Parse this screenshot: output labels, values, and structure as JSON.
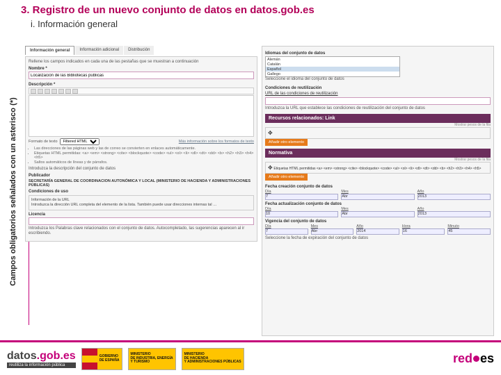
{
  "title": "3. Registro de un nuevo conjunto de datos en datos.gob.es",
  "subtitle": "i. Información general",
  "sidebar": "Campos obligatorios señalados con un asterisco (*)",
  "tabs": {
    "a": "Información general",
    "b": "Información adicional",
    "c": "Distribución"
  },
  "hint_top": "Rellene los campos indicados en cada una de las pestañas que se muestran a continuación",
  "nombre_label": "Nombre *",
  "nombre_value": "Localización de las Bibliotecas públicas",
  "desc_label": "Descripción *",
  "fmt_label": "Formato de texto",
  "fmt_opt": "Filtered HTML",
  "fmt_more": "Más información sobre los formatos de texto",
  "tips": {
    "a": "Las direcciones de las páginas web y las de correo se convierten en enlaces automáticamente.",
    "b": "Etiquetas HTML permitidas: <a> <em> <strong> <cite> <blockquote> <code> <ul> <ol> <li> <dl> <dt> <dd> <b> <h2> <h3> <h4> <h5>",
    "c": "Saltos automáticos de líneas y de párrafos."
  },
  "desc_hint": "Introduzca la descripción del conjunto de datos",
  "pub_label": "Publicador",
  "pub_value": "SECRETARÍA GENERAL DE COORDINACION AUTONÓMICA Y LOCAL (MINISTERIO DE HACIENDA Y ADMINISTRACIONES PÚBLICAS)",
  "url_label": "Condiciones de uso",
  "url_box_a": "Información de la URL",
  "url_box_b": "Introduzca la dirección URL completa del elemento de la lista. También puede usar direcciones internas tal …",
  "lic_label": "Licencia",
  "lic_hint": "Introduzca los Palabras clave relacionados con el conjunto de datos. Autocompletado, las sugerencias aparecen al ir escribiendo.",
  "idiomas_label": "Idiomas del conjunto de datos",
  "idiomas": {
    "a": "Alemán",
    "b": "Catalán",
    "c": "Español",
    "d": "Gallego"
  },
  "idiomas_hint": "Seleccione el idioma del conjunto de datos",
  "cond_label": "Condiciones de reutilización",
  "cond_sub": "URL de las condiciones de reutilización",
  "cond_hint": "Introduzca la URL que establece las condiciones de reutilización del conjunto de datos",
  "recursos_hdr": "Recursos relacionados: Link",
  "mostrar": "Mostrar pesos de la fila",
  "btn_add": "Añadir otro elemento",
  "normativa_hdr": "Normativa",
  "normativa_row": "Etiquetas HTML permitidas <a> <em> <strong> <cite> <blockquote> <code> <ul> <ol> <li> <dl> <dt> <dd> <b> <h2> <h3> <h4> <h5>",
  "date1_label": "Fecha creación conjunto de datos",
  "date2_label": "Fecha actualización conjunto de datos",
  "date3_label": "Vigencia del conjunto de datos",
  "dh": {
    "dia": "Día",
    "mes": "Mes",
    "anio": "Año",
    "hora": "Hora",
    "min": "Minuto"
  },
  "dv": {
    "d1": "7",
    "m1": "Abr",
    "y1": "2013",
    "d2": "10",
    "m2": "Abr",
    "y2": "2013",
    "d3": "7",
    "m3": "Abr",
    "y3": "2014",
    "h3": "16",
    "mi3": "45"
  },
  "date3_hint": "Seleccione la fecha de expiración del conjunto de datos",
  "footer": {
    "datos1": "datos",
    "datos2": ".gob.es",
    "datos_sub": "reutiliza la información pública",
    "gob1": "GOBIERNO",
    "gob2": "DE ESPAÑA",
    "min1a": "MINISTERIO",
    "min1b": "DE INDUSTRIA, ENERGÍA",
    "min1c": "Y TURISMO",
    "min2a": "MINISTERIO",
    "min2b": "DE HACIENDA",
    "min2c": "Y ADMINISTRACIONES PÚBLICAS",
    "red1": "red",
    "red2": "es"
  }
}
